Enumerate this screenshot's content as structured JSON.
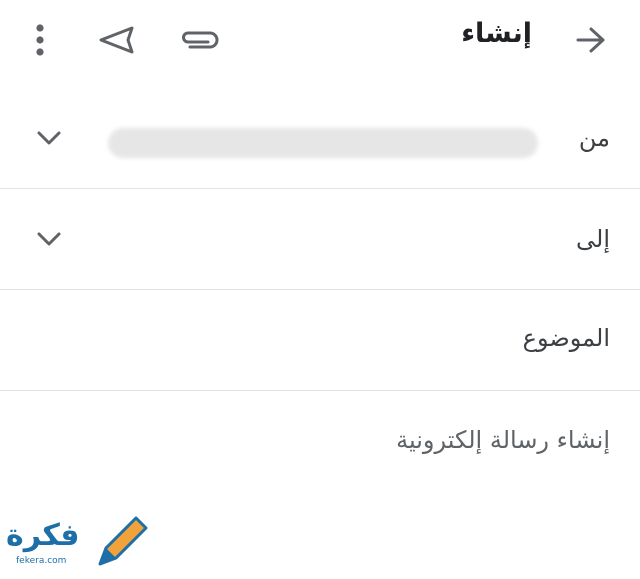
{
  "toolbar": {
    "title": "إنشاء",
    "back_icon": "arrow-right-icon",
    "attach_icon": "paperclip-icon",
    "send_icon": "send-icon",
    "more_icon": "more-vert-icon"
  },
  "fields": {
    "from_label": "من",
    "to_label": "إلى",
    "subject_placeholder": "الموضوع",
    "body_placeholder": "إنشاء رسالة إلكترونية"
  },
  "watermark": {
    "logo_text": "فكرة",
    "domain_text": "fekera.com"
  },
  "colors": {
    "icon": "#5f6368",
    "divider": "#e3e3e3",
    "watermark_blue": "#1e6fa8",
    "watermark_orange": "#f2a23a"
  }
}
